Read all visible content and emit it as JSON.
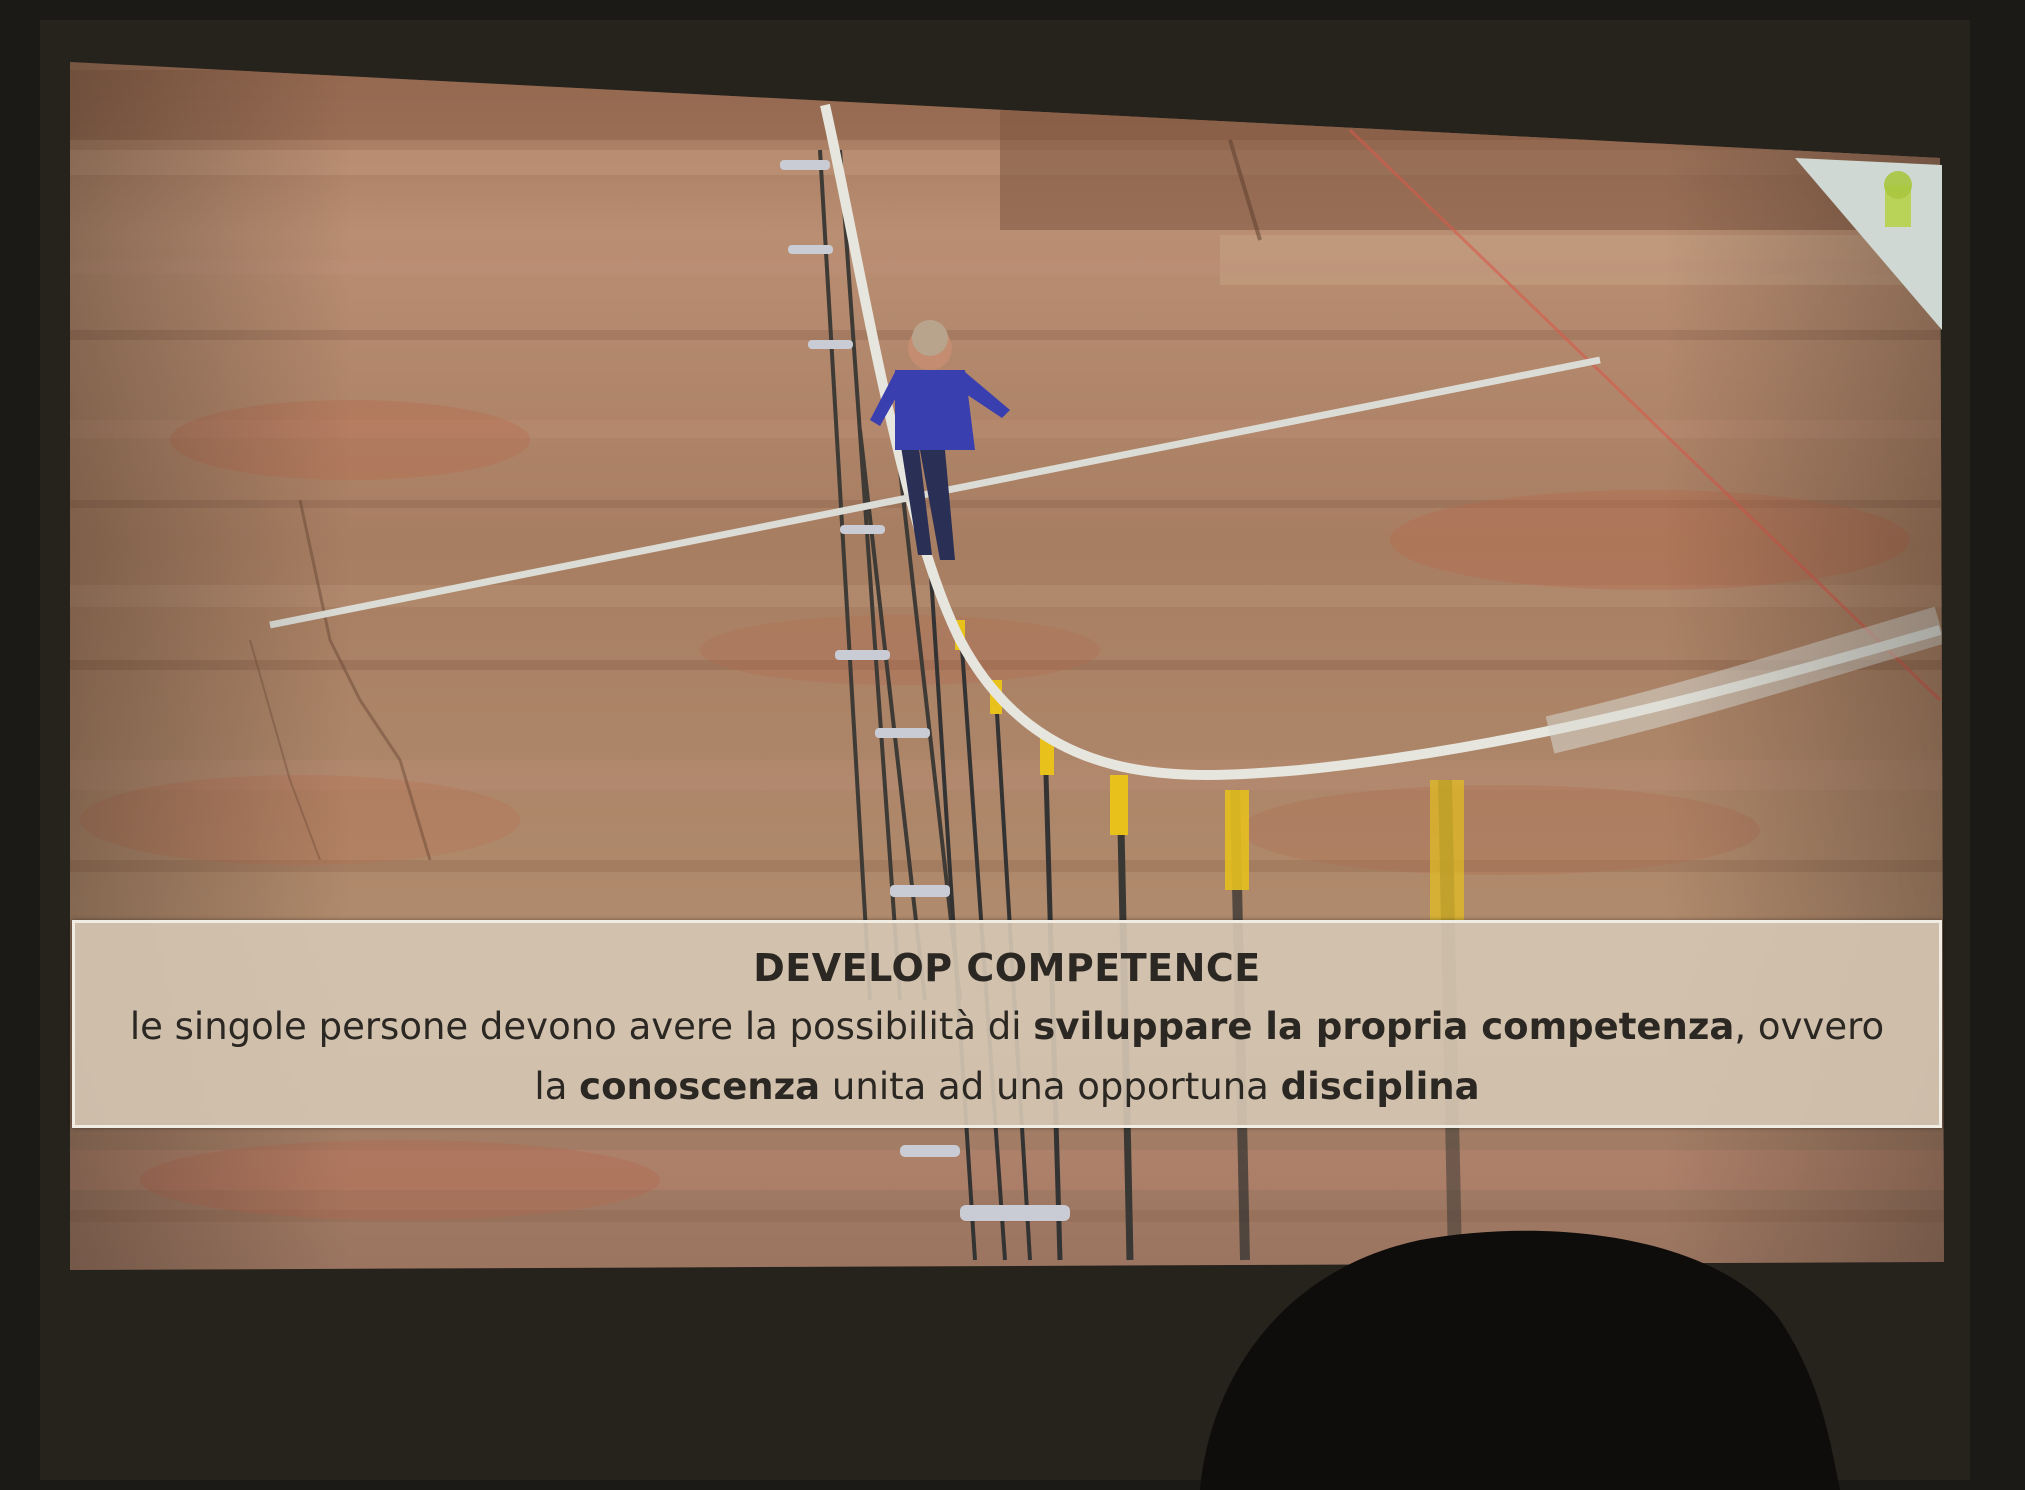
{
  "slide": {
    "title": "DEVELOP COMPETENCE",
    "body": {
      "t1": "le singole persone devono avere la possibilità di ",
      "b1": "sviluppare la propria competenza",
      "t2": ", ovvero la ",
      "b2": "conoscenza",
      "t3": " unita ad una opportuna ",
      "b3": "disciplina"
    }
  },
  "colors": {
    "room": "#1c1a16",
    "canyon_wall": "#a97f63",
    "caption_bg": "#d6c8b4",
    "shirt": "#3a3fb0",
    "cable": "#e4e4dc",
    "safety_marker": "#e8c21a"
  },
  "icons": {
    "corner_logo": "slide-logo-icon"
  }
}
